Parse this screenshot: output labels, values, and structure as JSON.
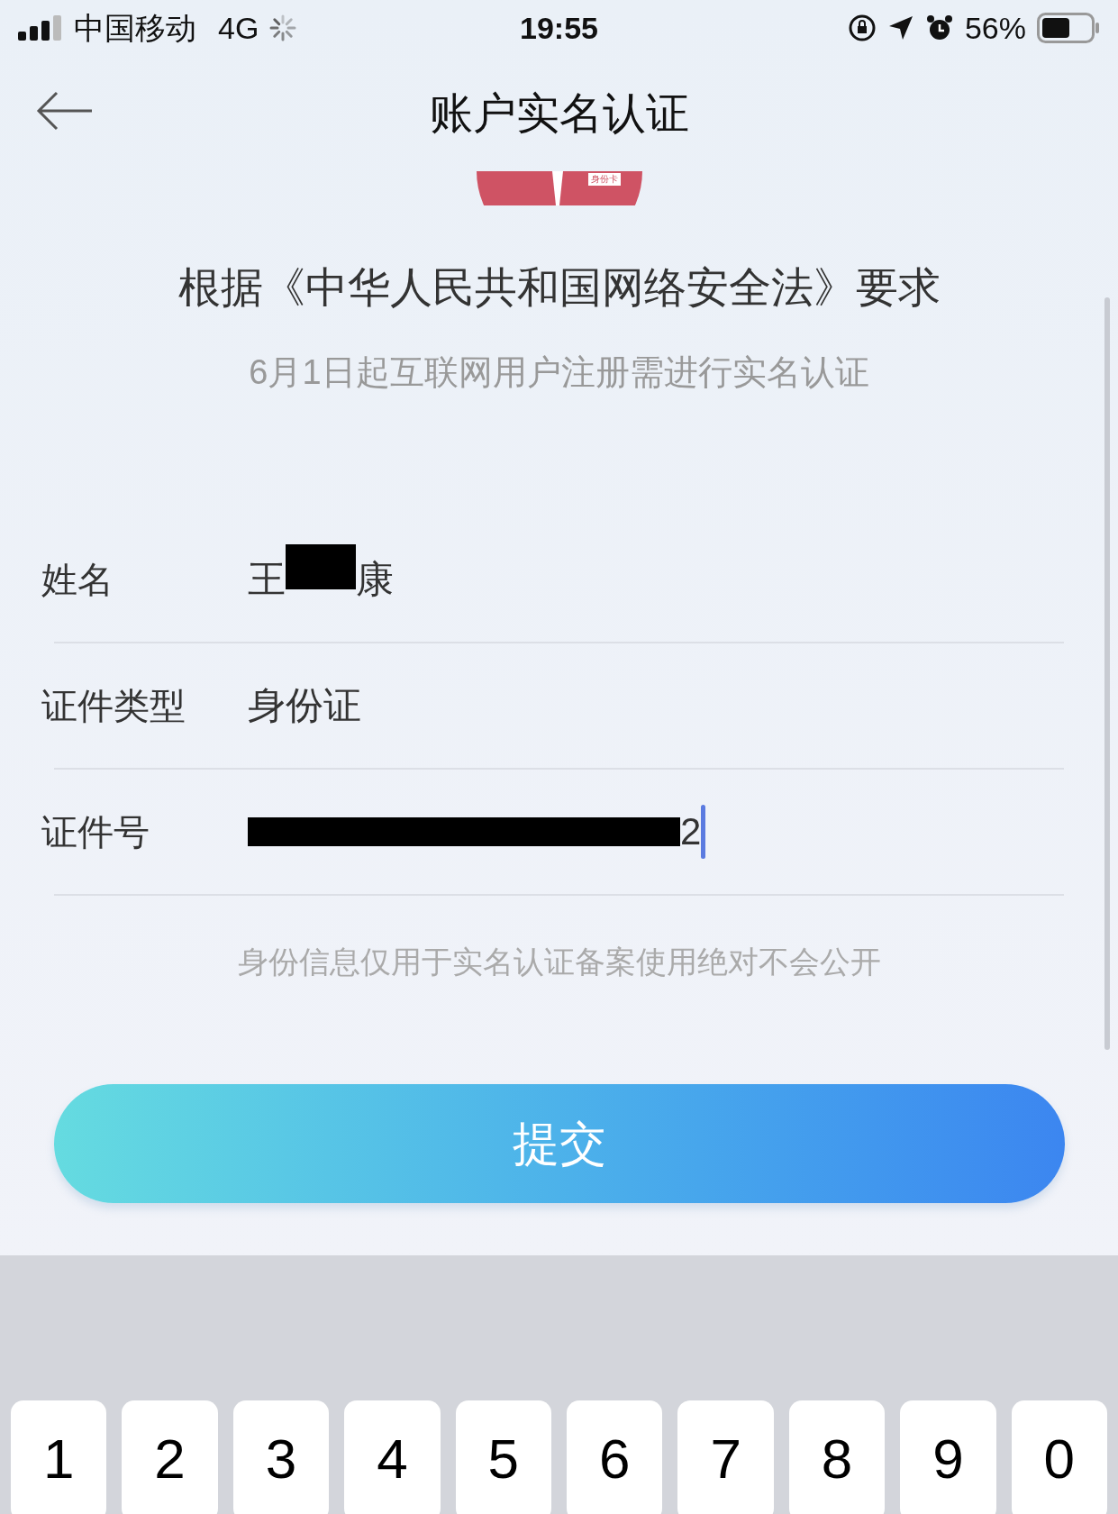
{
  "status_bar": {
    "carrier": "中国移动",
    "network": "4G",
    "time": "19:55",
    "battery": "56%"
  },
  "header": {
    "title": "账户实名认证"
  },
  "illustration": {
    "badge": "身份卡"
  },
  "intro": {
    "heading": "根据《中华人民共和国网络安全法》要求",
    "subtitle": "6月1日起互联网用户注册需进行实名认证"
  },
  "fields": [
    {
      "kind": "redacted-middle",
      "label": "姓名",
      "value_before": "王",
      "value_after": "康",
      "focused": false
    },
    {
      "kind": "plain",
      "label": "证件类型",
      "value": "身份证",
      "focused": false
    },
    {
      "kind": "redacted-start",
      "label": "证件号",
      "value": "2",
      "focused": true
    }
  ],
  "note": "身份信息仅用于实名认证备案使用绝对不会公开",
  "submit_button": "提交",
  "keyboard": {
    "keys": [
      "1",
      "2",
      "3",
      "4",
      "5",
      "6",
      "7",
      "8",
      "9",
      "0"
    ]
  }
}
